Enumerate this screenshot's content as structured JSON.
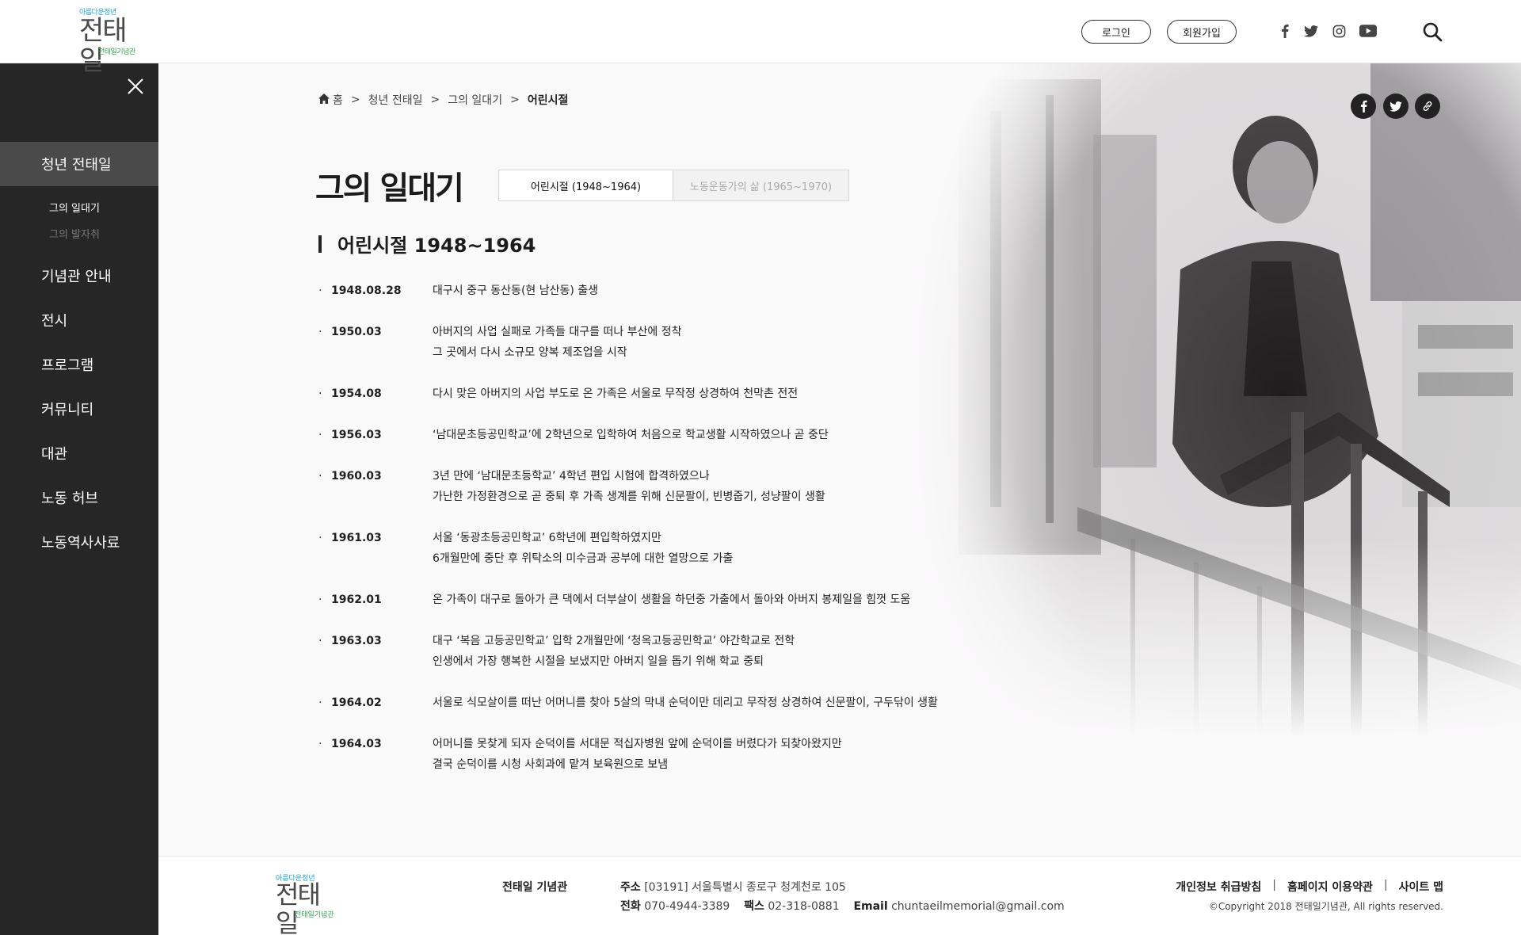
{
  "header": {
    "logo": {
      "top": "아름다운청년",
      "main": "전태일",
      "sub": "전태일기념관"
    },
    "login_label": "로그인",
    "join_label": "회원가입",
    "sns": [
      "facebook-icon",
      "twitter-icon",
      "instagram-icon",
      "youtube-icon"
    ]
  },
  "sidebar": {
    "items": [
      {
        "label": "청년 전태일",
        "active": true
      },
      {
        "label": "기념관 안내"
      },
      {
        "label": "전시"
      },
      {
        "label": "프로그램"
      },
      {
        "label": "커뮤니티"
      },
      {
        "label": "대관"
      },
      {
        "label": "노동 허브"
      },
      {
        "label": "노동역사사료"
      }
    ],
    "subitems": [
      {
        "label": "그의 일대기",
        "active": true
      },
      {
        "label": "그의 발자취",
        "active": false
      }
    ]
  },
  "breadcrumb": {
    "home": "홈",
    "sep": ">",
    "level1": "청년 전태일",
    "level2": "그의 일대기",
    "current": "어린시절"
  },
  "page": {
    "title": "그의 일대기",
    "tabs": [
      {
        "label": "어린시절 (1948~1964)",
        "active": true
      },
      {
        "label": "노동운동가의 삶 (1965~1970)",
        "active": false
      }
    ],
    "section_title": "어린시절 1948~1964"
  },
  "timeline": [
    {
      "date": "1948.08.28",
      "lines": [
        "대구시 중구 동산동(현 남산동) 출생"
      ]
    },
    {
      "date": "1950.03",
      "lines": [
        "아버지의 사업 실패로 가족들 대구를 떠나 부산에 정착",
        "그 곳에서 다시 소규모 양복 제조업을 시작"
      ]
    },
    {
      "date": "1954.08",
      "lines": [
        "다시 맞은 아버지의 사업 부도로 온 가족은 서울로 무작정 상경하여 천막촌 전전"
      ]
    },
    {
      "date": "1956.03",
      "lines": [
        "‘남대문초등공민학교’에 2학년으로 입학하여 처음으로 학교생활 시작하였으나 곧 중단"
      ]
    },
    {
      "date": "1960.03",
      "lines": [
        "3년 만에 ‘남대문초등학교’ 4학년 편입 시험에 합격하였으나",
        "가난한 가정환경으로 곧 중퇴 후 가족 생계를 위해 신문팔이, 빈병줍기, 성냥팔이 생활"
      ]
    },
    {
      "date": "1961.03",
      "lines": [
        "서울 ‘동광초등공민학교’ 6학년에 편입학하였지만",
        "6개월만에 중단 후 위탁소의 미수금과 공부에 대한 열망으로 가출"
      ]
    },
    {
      "date": "1962.01",
      "lines": [
        "온 가족이 대구로 돌아가 큰 댁에서 더부살이 생활을 하던중 가출에서 돌아와 아버지 봉제일을 힘껏 도움"
      ]
    },
    {
      "date": "1963.03",
      "lines": [
        "대구 ‘복음 고등공민학교’ 입학 2개월만에 ‘청옥고등공민학교’ 야간학교로 전학",
        "인생에서 가장 행복한 시절을 보냈지만 아버지 일을 돕기 위해 학교 중퇴"
      ]
    },
    {
      "date": "1964.02",
      "lines": [
        "서울로 식모살이를 떠난 어머니를 찾아 5살의 막내 순덕이만 데리고 무작정 상경하여 신문팔이, 구두닦이 생활"
      ]
    },
    {
      "date": "1964.03",
      "lines": [
        "어머니를 못찾게 되자 순덕이를 서대문 적십자병원 앞에 순덕이를 버렸다가 되찾아왔지만",
        "결국 순덕이를 시청 사회과에 맡겨 보육원으로 보냄"
      ]
    }
  ],
  "share": [
    "facebook-icon",
    "twitter-icon",
    "link-icon"
  ],
  "footer": {
    "logo": {
      "top": "아름다운청년",
      "main": "전태일",
      "sub": "전태일기념관"
    },
    "name": "전태일 기념관",
    "address_label": "주소",
    "address": "[03191] 서울특별시 종로구 청계천로 105",
    "phone_label": "전화",
    "phone": "070-4944-3389",
    "fax_label": "팩스",
    "fax": "02-318-0881",
    "email_label": "Email",
    "email": "chuntaeilmemorial@gmail.com",
    "links": [
      "개인정보 취급방침",
      "홈페이지 이용약관",
      "사이트 맵"
    ],
    "link_sep": "|",
    "copyright": "©Copyright 2018 전태일기념관, All rights reserved."
  },
  "colors": {
    "sidebar_bg": "#262626",
    "sidebar_active": "#4a4a4a",
    "logo_blue": "#1aa7e0",
    "logo_green": "#33a34a"
  }
}
